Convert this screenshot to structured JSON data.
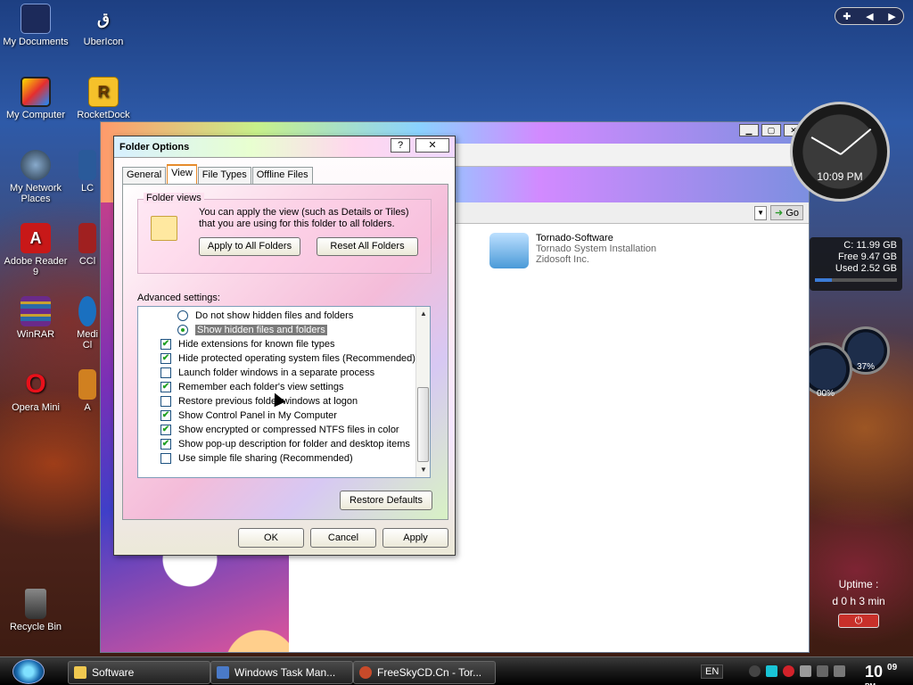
{
  "desktop": {
    "icons": [
      {
        "label": "My Documents",
        "icon": "folder-icon"
      },
      {
        "label": "UberIcon",
        "icon": "ubericon-icon"
      },
      {
        "label": "My Computer",
        "icon": "computer-icon"
      },
      {
        "label": "RocketDock",
        "icon": "rocketdock-icon"
      },
      {
        "label": "My Network Places",
        "icon": "network-icon"
      },
      {
        "label": "Adobe Reader 9",
        "icon": "adobe-reader-icon"
      },
      {
        "label": "WinRAR",
        "icon": "winrar-icon"
      },
      {
        "label": "Opera Mini",
        "icon": "opera-icon"
      },
      {
        "label": "Recycle Bin",
        "icon": "recycle-bin-icon"
      },
      {
        "label": "LC",
        "icon": "app-icon"
      },
      {
        "label": "CCl",
        "icon": "app-icon"
      },
      {
        "label": "Medi Cl",
        "icon": "app-icon"
      },
      {
        "label": "A",
        "icon": "app-icon"
      }
    ]
  },
  "explorer": {
    "go_label": "Go",
    "item": {
      "name": "Tornado-Software",
      "desc": "Tornado System Installation",
      "company": "Zidosoft Inc."
    }
  },
  "dialog": {
    "title": "Folder Options",
    "help_label": "?",
    "close_label": "✕",
    "tabs": [
      "General",
      "View",
      "File Types",
      "Offline Files"
    ],
    "active_tab": "View",
    "folder_views": {
      "legend": "Folder views",
      "text": "You can apply the view (such as Details or Tiles) that you are using for this folder to all folders.",
      "apply_button": "Apply to All Folders",
      "reset_button": "Reset All Folders"
    },
    "advanced_label": "Advanced settings:",
    "settings": [
      {
        "label": "Do not show hidden files and folders",
        "type": "radio",
        "checked": false,
        "indent": true
      },
      {
        "label": "Show hidden files and folders",
        "type": "radio",
        "checked": true,
        "indent": true,
        "selected": true
      },
      {
        "label": "Hide extensions for known file types",
        "type": "check",
        "checked": true
      },
      {
        "label": "Hide protected operating system files (Recommended)",
        "type": "check",
        "checked": true
      },
      {
        "label": "Launch folder windows in a separate process",
        "type": "check",
        "checked": false
      },
      {
        "label": "Remember each folder's view settings",
        "type": "check",
        "checked": true
      },
      {
        "label": "Restore previous folder windows at logon",
        "type": "check",
        "checked": false
      },
      {
        "label": "Show Control Panel in My Computer",
        "type": "check",
        "checked": true
      },
      {
        "label": "Show encrypted or compressed NTFS files in color",
        "type": "check",
        "checked": true
      },
      {
        "label": "Show pop-up description for folder and desktop items",
        "type": "check",
        "checked": true
      },
      {
        "label": "Use simple file sharing (Recommended)",
        "type": "check",
        "checked": false
      }
    ],
    "restore_defaults": "Restore Defaults",
    "ok": "OK",
    "cancel": "Cancel",
    "apply": "Apply"
  },
  "gadgets": {
    "clock_time": "10:09 PM",
    "disk": {
      "drive": "C:  11.99 GB",
      "free": "Free 9.47 GB",
      "used": "Used 2.52 GB",
      "used_fraction": 0.21
    },
    "meter1": "37%",
    "meter2": "00%",
    "uptime_label": "Uptime :",
    "uptime_value": "d 0 h 3 min"
  },
  "taskbar": {
    "buttons": [
      "Software",
      "Windows Task Man...",
      "FreeSkyCD.Cn - Tor..."
    ],
    "lang": "EN",
    "clock_hour": "10",
    "clock_min": "09",
    "clock_ampm": "PM"
  }
}
